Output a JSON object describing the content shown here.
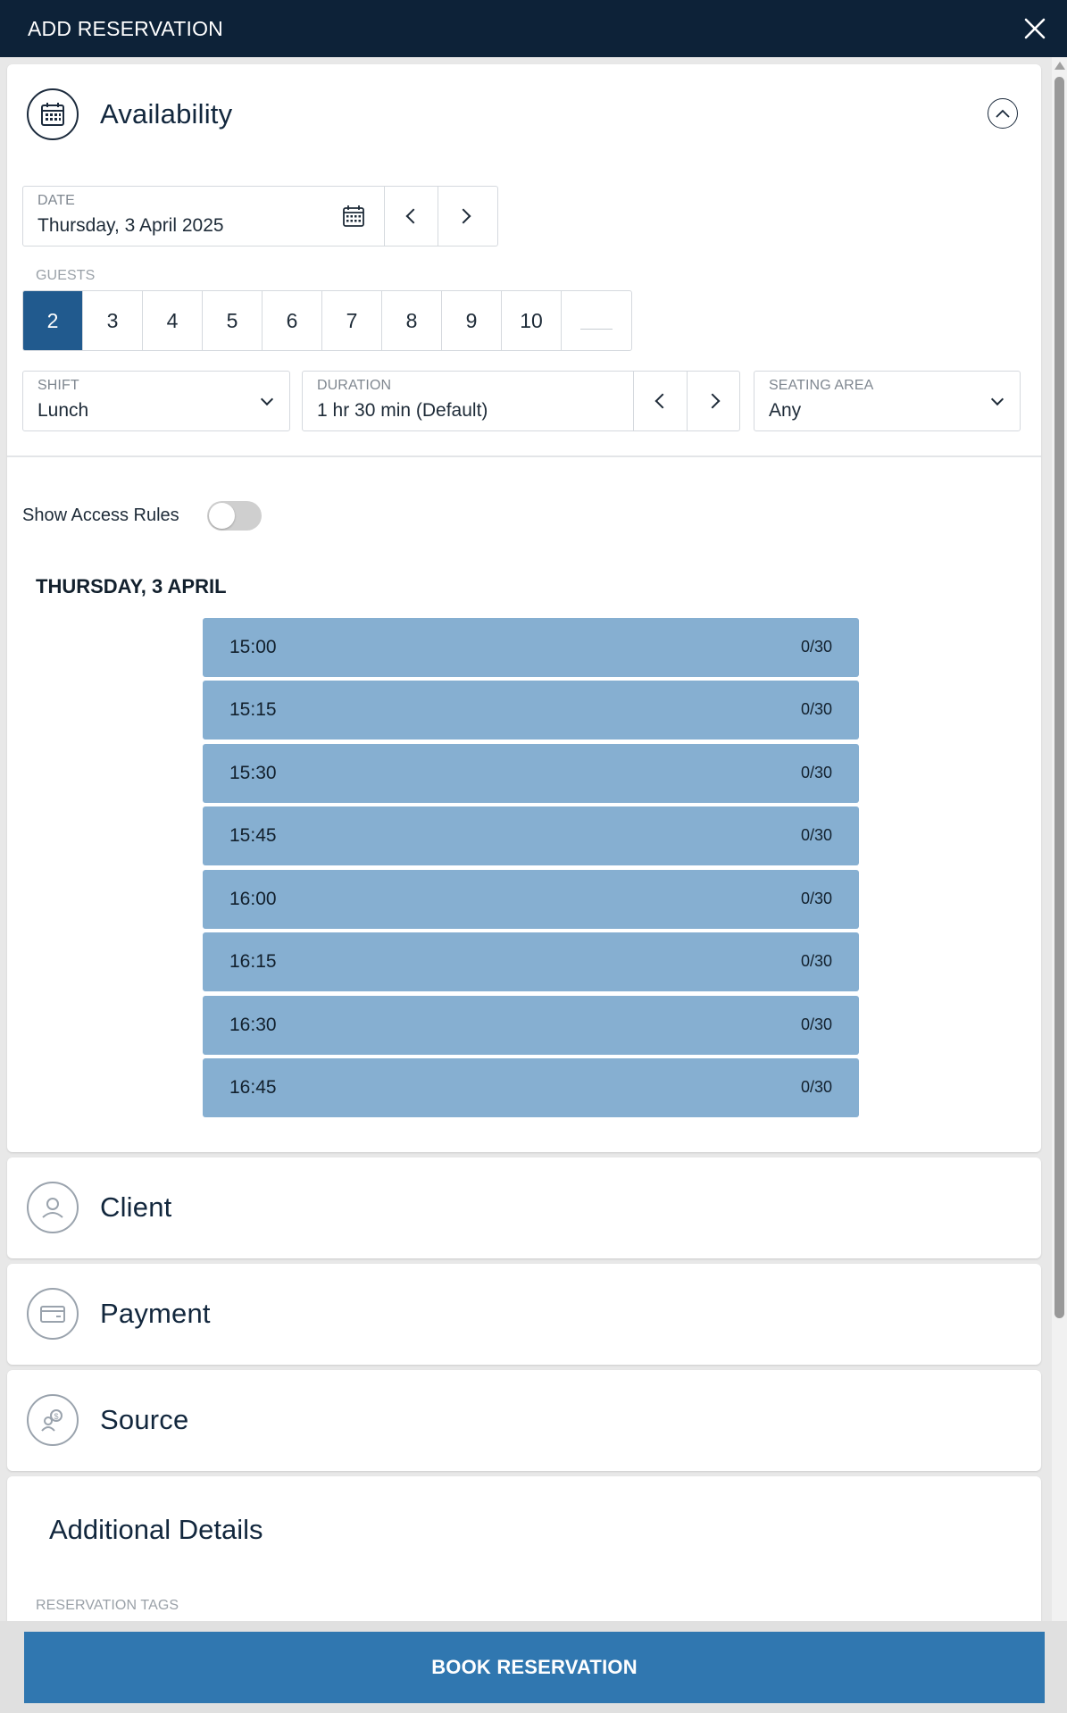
{
  "header": {
    "title": "ADD RESERVATION"
  },
  "availability": {
    "title": "Availability",
    "date": {
      "label": "DATE",
      "value": "Thursday, 3 April 2025"
    },
    "guests": {
      "label": "GUESTS",
      "options": [
        "2",
        "3",
        "4",
        "5",
        "6",
        "7",
        "8",
        "9",
        "10"
      ],
      "selected": "2"
    },
    "shift": {
      "label": "SHIFT",
      "value": "Lunch"
    },
    "duration": {
      "label": "DURATION",
      "value": "1 hr 30 min (Default)"
    },
    "seating": {
      "label": "SEATING AREA",
      "value": "Any"
    },
    "access_rules_label": "Show Access Rules",
    "day_heading": "THURSDAY, 3 APRIL",
    "slots": [
      {
        "time": "15:00",
        "count": "0/30"
      },
      {
        "time": "15:15",
        "count": "0/30"
      },
      {
        "time": "15:30",
        "count": "0/30"
      },
      {
        "time": "15:45",
        "count": "0/30"
      },
      {
        "time": "16:00",
        "count": "0/30"
      },
      {
        "time": "16:15",
        "count": "0/30"
      },
      {
        "time": "16:30",
        "count": "0/30"
      },
      {
        "time": "16:45",
        "count": "0/30"
      }
    ]
  },
  "client": {
    "title": "Client"
  },
  "payment": {
    "title": "Payment"
  },
  "source": {
    "title": "Source"
  },
  "additional": {
    "title": "Additional Details",
    "tags_label": "RESERVATION TAGS"
  },
  "footer": {
    "book_label": "BOOK RESERVATION"
  },
  "colors": {
    "header_bg": "#0d2238",
    "primary": "#3077b0",
    "selected_guest": "#215a8e",
    "slot": "#86afd1"
  },
  "icons": [
    "close-icon",
    "calendar-icon",
    "chevron-up-icon",
    "chevron-left-icon",
    "chevron-right-icon",
    "chevron-down-icon",
    "user-icon",
    "card-icon",
    "source-icon"
  ]
}
